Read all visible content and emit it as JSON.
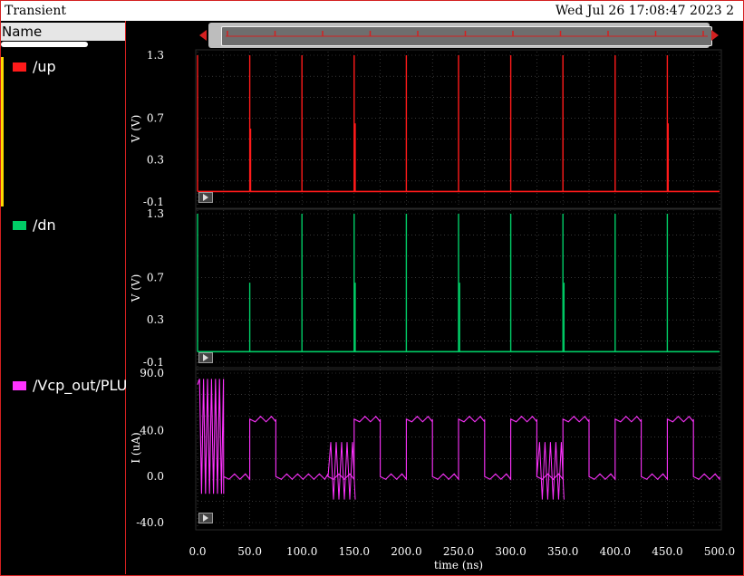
{
  "window": {
    "title": "Transient",
    "timestamp": "Wed Jul 26 17:08:47 2023  2"
  },
  "sidebar": {
    "header": "Name",
    "items": [
      {
        "label": "/up",
        "color": "#ff1a1a"
      },
      {
        "label": "/dn",
        "color": "#00cc66"
      },
      {
        "label": "/Vcp_out/PLU",
        "color": "#ff33ff"
      }
    ]
  },
  "chart_data": {
    "type": "line",
    "xlabel": "time (ns)",
    "xlim": [
      0,
      500
    ],
    "xticks": [
      "0.0",
      "50.0",
      "100.0",
      "150.0",
      "200.0",
      "250.0",
      "300.0",
      "350.0",
      "400.0",
      "450.0",
      "500.0"
    ],
    "background": "#000000",
    "grid": true,
    "panels": [
      {
        "name": "/up",
        "color": "#ff1a1a",
        "ylabel": "V (V)",
        "ylim": [
          -0.1,
          1.3
        ],
        "yticks": [
          "1.3",
          "0.7",
          "0.3",
          "-0.1"
        ],
        "baseline": 0.0,
        "pulses": [
          [
            0,
            1.3
          ],
          [
            50,
            1.3
          ],
          [
            50.8,
            0.6
          ],
          [
            100,
            1.3
          ],
          [
            150,
            1.3
          ],
          [
            151,
            0.65
          ],
          [
            200,
            1.3
          ],
          [
            250,
            1.3
          ],
          [
            300,
            1.3
          ],
          [
            350,
            1.3
          ],
          [
            400,
            1.3
          ],
          [
            450,
            1.3
          ],
          [
            450.8,
            0.65
          ]
        ]
      },
      {
        "name": "/dn",
        "color": "#00cc66",
        "ylabel": "V (V)",
        "ylim": [
          -0.1,
          1.3
        ],
        "yticks": [
          "1.3",
          "0.7",
          "0.3",
          "-0.1"
        ],
        "baseline": 0.0,
        "pulses": [
          [
            0,
            1.3
          ],
          [
            50,
            0.65
          ],
          [
            100,
            1.3
          ],
          [
            150,
            1.3
          ],
          [
            151,
            0.65
          ],
          [
            200,
            1.3
          ],
          [
            250,
            1.3
          ],
          [
            251,
            0.65
          ],
          [
            300,
            1.3
          ],
          [
            350,
            1.3
          ],
          [
            351,
            0.65
          ],
          [
            400,
            1.3
          ],
          [
            450,
            1.3
          ]
        ]
      },
      {
        "name": "/Vcp_out/PLU",
        "color": "#ff33ff",
        "ylabel": "I (uA)",
        "ylim": [
          -40,
          90
        ],
        "yticks": [
          "90.0",
          "40.0",
          "0.0",
          "-40.0"
        ],
        "square_wave": [
          {
            "x0": 0,
            "x1": 25,
            "level": "osc"
          },
          {
            "x0": 25,
            "x1": 50,
            "level": 0
          },
          {
            "x0": 50,
            "x1": 75,
            "level": 50
          },
          {
            "x0": 75,
            "x1": 125,
            "level": 0
          },
          {
            "x0": 125,
            "x1": 150,
            "level": 0
          },
          {
            "x0": 150,
            "x1": 175,
            "level": 50
          },
          {
            "x0": 175,
            "x1": 200,
            "level": 0
          },
          {
            "x0": 200,
            "x1": 225,
            "level": 50
          },
          {
            "x0": 225,
            "x1": 250,
            "level": 0
          },
          {
            "x0": 250,
            "x1": 275,
            "level": 50
          },
          {
            "x0": 275,
            "x1": 300,
            "level": 0
          },
          {
            "x0": 300,
            "x1": 325,
            "level": 50
          },
          {
            "x0": 325,
            "x1": 350,
            "level": 0
          },
          {
            "x0": 350,
            "x1": 375,
            "level": 50
          },
          {
            "x0": 375,
            "x1": 400,
            "level": 0
          },
          {
            "x0": 400,
            "x1": 425,
            "level": 50
          },
          {
            "x0": 425,
            "x1": 450,
            "level": 0
          },
          {
            "x0": 450,
            "x1": 475,
            "level": 50
          },
          {
            "x0": 475,
            "x1": 500,
            "level": 0
          }
        ]
      }
    ]
  }
}
